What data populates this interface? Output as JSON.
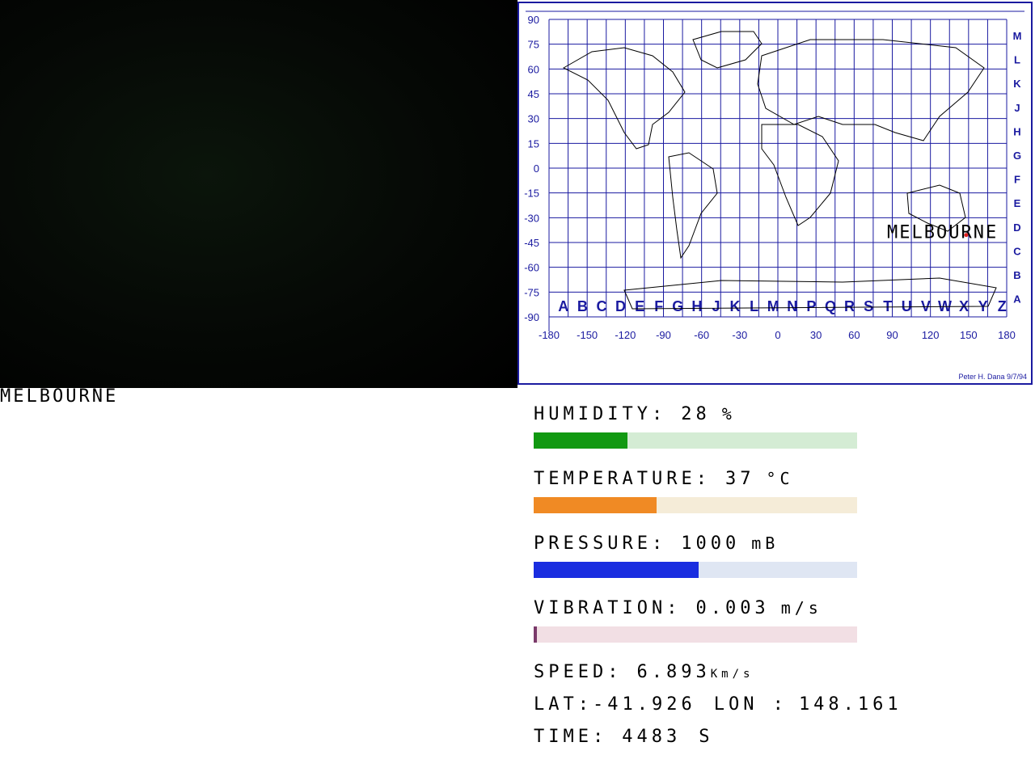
{
  "camera": {
    "label": "MELBOURNE"
  },
  "map": {
    "lat_labels": [
      "90",
      "75",
      "60",
      "45",
      "30",
      "15",
      "0",
      "-15",
      "-30",
      "-45",
      "-60",
      "-75",
      "-90"
    ],
    "lon_labels": [
      "-180",
      "-150",
      "-120",
      "-90",
      "-60",
      "-30",
      "0",
      "30",
      "60",
      "90",
      "120",
      "150",
      "180"
    ],
    "column_letters": [
      "A",
      "B",
      "C",
      "D",
      "E",
      "F",
      "G",
      "H",
      "J",
      "K",
      "L",
      "M",
      "N",
      "P",
      "Q",
      "R",
      "S",
      "T",
      "U",
      "V",
      "W",
      "X",
      "Y",
      "Z"
    ],
    "row_letters": [
      "M",
      "L",
      "K",
      "J",
      "H",
      "G",
      "F",
      "E",
      "D",
      "C",
      "B",
      "A"
    ],
    "credit": "Peter H. Dana 9/7/94",
    "marker_label": "MELBOURNE",
    "marker_lat": -41.926,
    "marker_lon": 148.161,
    "grid_color": "#1a1aa0"
  },
  "stats": {
    "humidity": {
      "label": "HUMIDITY:",
      "value": "28",
      "unit": "%",
      "fraction": 0.29,
      "color": "#119911",
      "track": "#d4ecd4"
    },
    "temperature": {
      "label": "TEMPERATURE:",
      "value": "37",
      "unit": "°C",
      "fraction": 0.38,
      "color": "#f08a24",
      "track": "#f5ecd8"
    },
    "pressure": {
      "label": "PRESSURE:",
      "value": "1000",
      "unit": "mB",
      "fraction": 0.51,
      "color": "#1a2de0",
      "track": "#dfe6f3"
    },
    "vibration": {
      "label": "VIBRATION:",
      "value": "0.003",
      "unit": "m/s",
      "fraction": 0.01,
      "color": "#7a3a6a",
      "track": "#f2dfe4"
    },
    "speed": {
      "label": "SPEED:",
      "value": "6.893",
      "unit": "Km/s"
    },
    "lat": {
      "label": "LAT:",
      "value": "-41.926"
    },
    "lon": {
      "label": "LON :",
      "value": "148.161"
    },
    "time": {
      "label": "TIME:",
      "value": "4483",
      "unit": "S"
    }
  }
}
